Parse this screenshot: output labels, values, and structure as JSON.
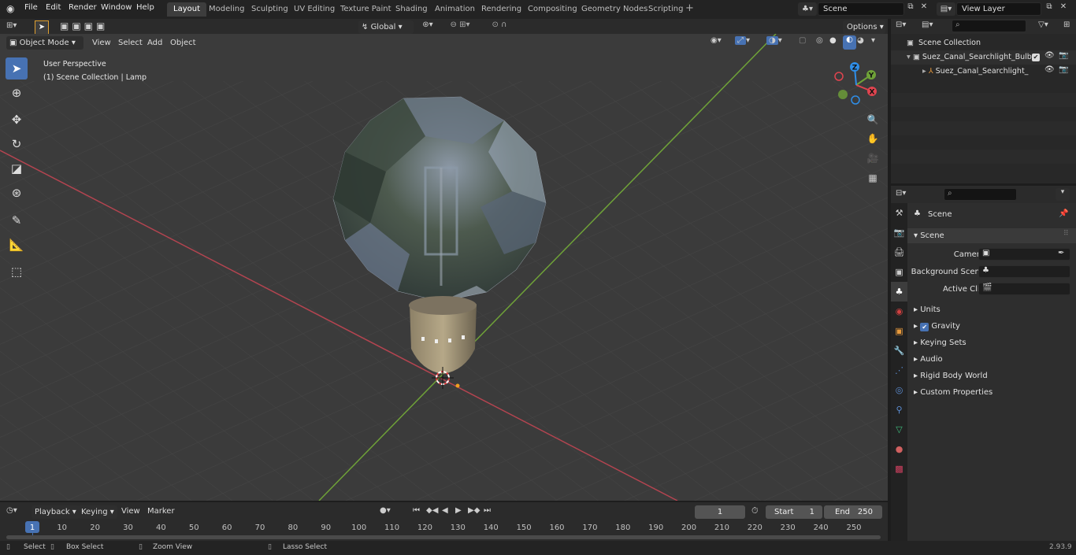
{
  "menus": [
    "File",
    "Edit",
    "Render",
    "Window",
    "Help"
  ],
  "workspaces": [
    "Layout",
    "Modeling",
    "Sculpting",
    "UV Editing",
    "Texture Paint",
    "Shading",
    "Animation",
    "Rendering",
    "Compositing",
    "Geometry Nodes",
    "Scripting"
  ],
  "scene_field": "Scene",
  "view_layer_field": "View Layer",
  "viewport": {
    "mode": "Object Mode",
    "view": "View",
    "select": "Select",
    "add": "Add",
    "object": "Object",
    "orientation": "Global",
    "options": "Options",
    "perspective": "User Perspective",
    "context": "(1) Scene Collection | Lamp",
    "axes": {
      "x": "X",
      "y": "Y",
      "z": "Z"
    }
  },
  "outliner": {
    "collection": "Scene Collection",
    "item1": "Suez_Canal_Searchlight_Bulb",
    "item2": "Suez_Canal_Searchlight_"
  },
  "properties": {
    "header": "Scene",
    "panel": "Scene",
    "camera_label": "Camera",
    "background_label": "Background Scene",
    "clip_label": "Active Clip",
    "sections": [
      "Units",
      "Gravity",
      "Keying Sets",
      "Audio",
      "Rigid Body World",
      "Custom Properties"
    ]
  },
  "timeline": {
    "playback": "Playback",
    "keying": "Keying",
    "view": "View",
    "marker": "Marker",
    "current_frame": "1",
    "start_label": "Start",
    "start": "1",
    "end_label": "End",
    "end": "250",
    "ruler": [
      "1",
      "10",
      "20",
      "30",
      "40",
      "50",
      "60",
      "70",
      "80",
      "90",
      "100",
      "110",
      "120",
      "130",
      "140",
      "150",
      "160",
      "170",
      "180",
      "190",
      "200",
      "210",
      "220",
      "230",
      "240",
      "250"
    ]
  },
  "status": {
    "select": "Select",
    "box_select": "Box Select",
    "zoom_view": "Zoom View",
    "lasso_select": "Lasso Select",
    "version": "2.93.9"
  },
  "colors": {
    "accent": "#4772b3",
    "x_axis": "#e0444f",
    "y_axis": "#8bc53f",
    "z_axis": "#2f8ee8"
  }
}
